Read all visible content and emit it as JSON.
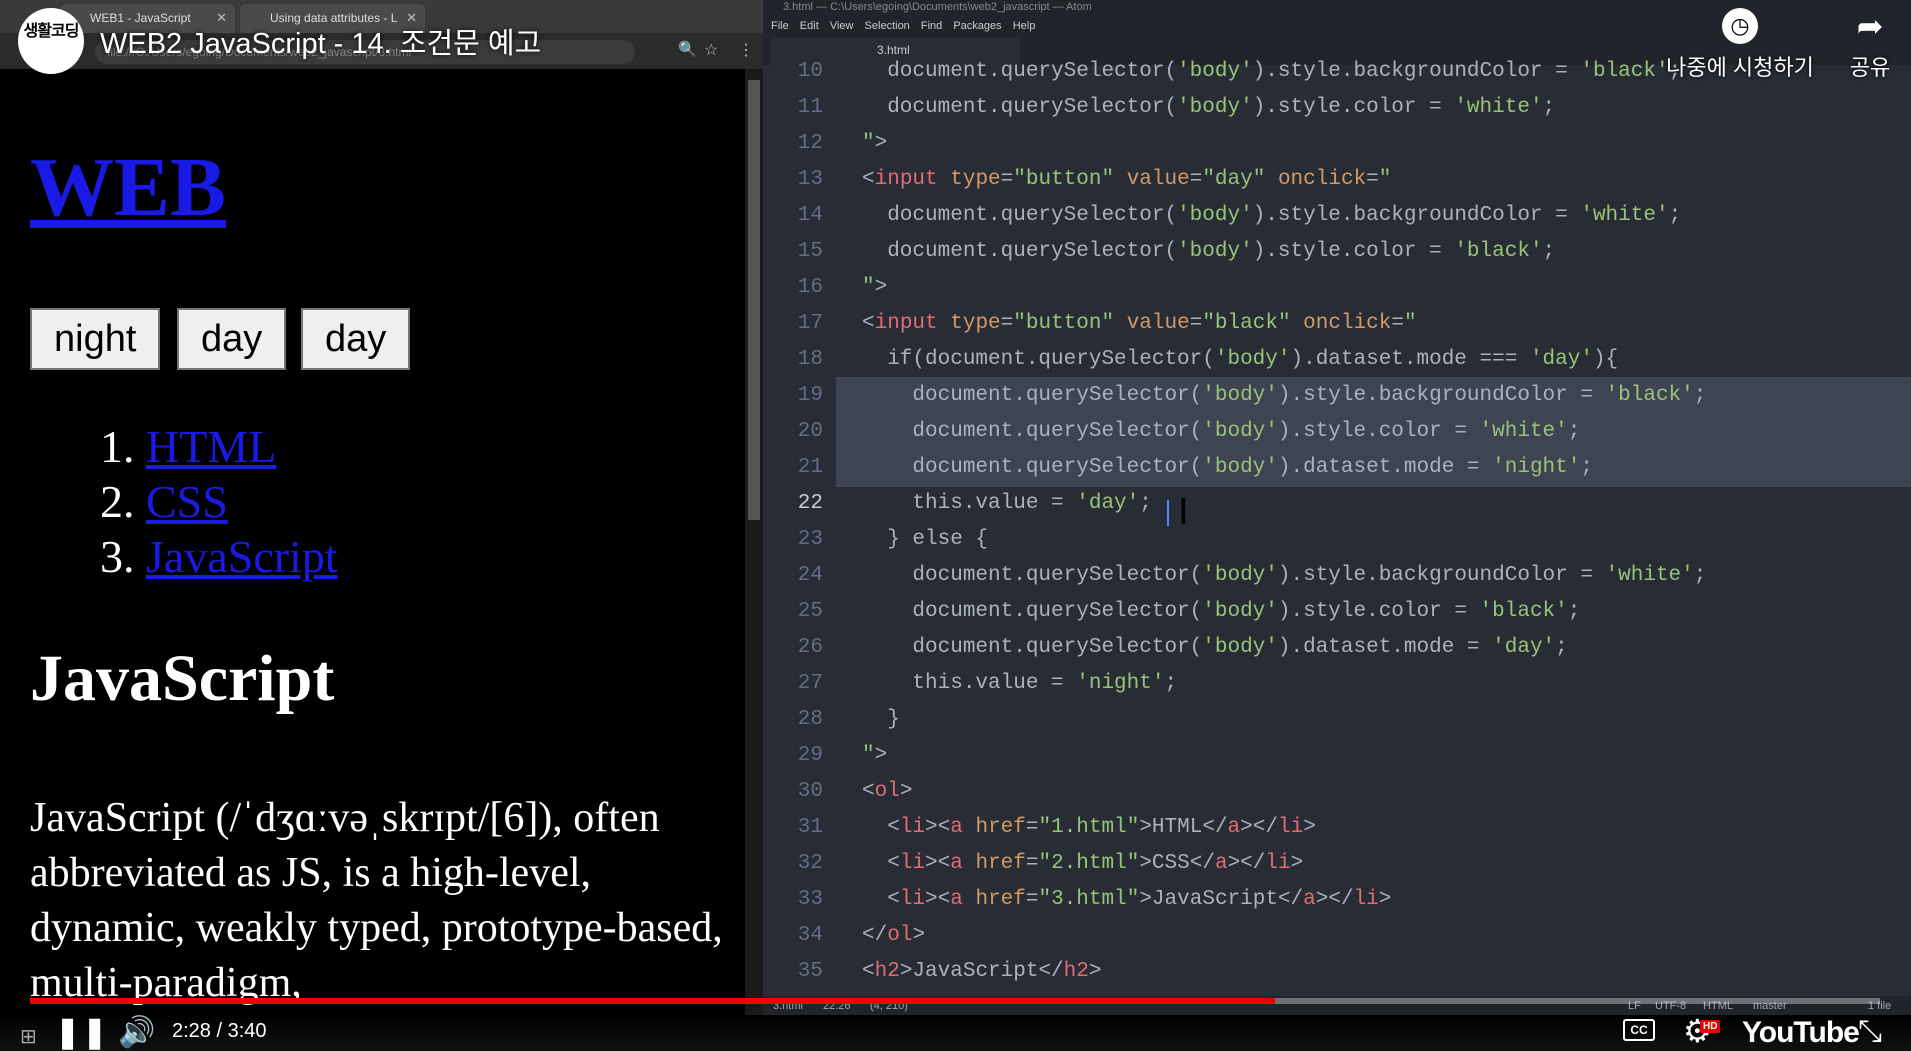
{
  "video": {
    "title": "WEB2 JavaScript - 14. 조건문 예고",
    "channel_logo": "생활코딩",
    "watch_later": "나중에 시청하기",
    "share": "공유",
    "time": "2:28 / 3:40",
    "progress": 0.673,
    "brand": "YouTube",
    "hd": "HD",
    "cc": "CC"
  },
  "browser": {
    "tabs": [
      {
        "label": "WEB1 - JavaScript"
      },
      {
        "label": "Using data attributes - L"
      }
    ],
    "address": "file:///C:/Users/egoing/Documents/web2_javascript/3.html"
  },
  "webpage": {
    "h1": "WEB",
    "buttons": [
      "night",
      "day",
      "day"
    ],
    "list": [
      {
        "num": "1.",
        "label": "HTML"
      },
      {
        "num": "2.",
        "label": "CSS"
      },
      {
        "num": "3.",
        "label": "JavaScript"
      }
    ],
    "h2": "JavaScript",
    "paragraph": "JavaScript (/ˈdʒɑːvəˌskrɪpt/[6]), often abbreviated as JS, is a high-level, dynamic, weakly typed, prototype-based, multi-paradigm,"
  },
  "editor": {
    "title": "3.html — C:\\Users\\egoing\\Documents\\web2_javascript — Atom",
    "menu": [
      "File",
      "Edit",
      "View",
      "Selection",
      "Find",
      "Packages",
      "Help"
    ],
    "tab": "3.html",
    "line_numbers": [
      "10",
      "11",
      "12",
      "13",
      "14",
      "15",
      "16",
      "17",
      "18",
      "19",
      "20",
      "21",
      "22",
      "23",
      "24",
      "25",
      "26",
      "27",
      "28",
      "29",
      "30",
      "31",
      "32",
      "33",
      "34",
      "35"
    ],
    "status": {
      "file": "3.html",
      "cursor": "22:26",
      "selection": "(4, 210)",
      "eol": "LF",
      "encoding": "UTF-8",
      "grammar": "HTML",
      "branch": "master",
      "files": "1 file"
    }
  },
  "colors": {
    "link": "#1a1ae6",
    "editor_bg": "#282c34",
    "tag": "#e06c75",
    "attr": "#d19a66",
    "string": "#98c379",
    "progress": "#e00000"
  }
}
